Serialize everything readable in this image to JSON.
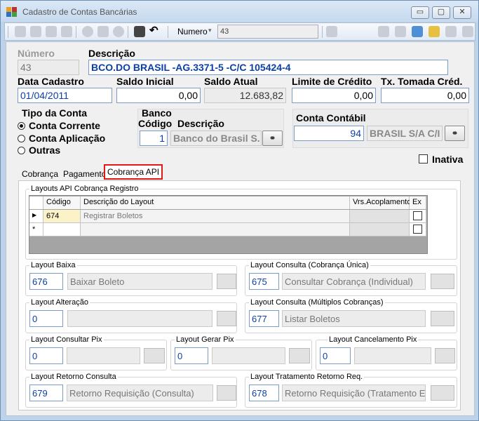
{
  "window": {
    "title": "Cadastro de Contas Bancárias"
  },
  "toolbar": {
    "numero_label": "Numero",
    "numero_value": "43"
  },
  "form": {
    "numero_label": "Número",
    "numero_value": "43",
    "descricao_label": "Descrição",
    "descricao_value": "BCO.DO BRASIL -AG.3371-5 -C/C 105424-4",
    "data_cadastro_label": "Data Cadastro",
    "data_cadastro_value": "01/04/2011",
    "saldo_inicial_label": "Saldo Inicial",
    "saldo_inicial_value": "0,00",
    "saldo_atual_label": "Saldo Atual",
    "saldo_atual_value": "12.683,82",
    "limite_credito_label": "Limite de Crédito",
    "limite_credito_value": "0,00",
    "tx_tomada_label": "Tx. Tomada Créd.",
    "tx_tomada_value": "0,00",
    "tipo_conta_label": "Tipo da Conta",
    "tipo_options": [
      {
        "label": "Conta Corrente",
        "selected": true
      },
      {
        "label": "Conta Aplicação",
        "selected": false
      },
      {
        "label": "Outras",
        "selected": false
      }
    ],
    "banco_label": "Banco",
    "banco_codigo_label": "Código",
    "banco_descricao_label": "Descrição",
    "banco_codigo_value": "1",
    "banco_descricao_value": "Banco do Brasil S.",
    "conta_contabil_label": "Conta Contábil",
    "conta_contabil_codigo": "94",
    "conta_contabil_desc": "BRASIL S/A C/I",
    "inativa_label": "Inativa"
  },
  "tabs": [
    {
      "label": "Cobrança"
    },
    {
      "label": "Pagamento"
    },
    {
      "label": "Cobrança API",
      "active": true
    }
  ],
  "cobranca_api": {
    "layouts_registro_label": "Layouts API Cobrança Registro",
    "grid": {
      "columns": [
        "Código",
        "Descrição do Layout",
        "Vrs.Acoplamento",
        "Ex"
      ],
      "rows": [
        {
          "codigo": "674",
          "descricao": "Registrar Boletos"
        }
      ]
    },
    "layout_baixa": {
      "label": "Layout Baixa",
      "code": "676",
      "desc": "Baixar Boleto"
    },
    "layout_consulta_unica": {
      "label": "Layout Consulta (Cobrança Única)",
      "code": "675",
      "desc": "Consultar Cobrança (Individual)"
    },
    "layout_alteracao": {
      "label": "Layout Alteração",
      "code": "0",
      "desc": ""
    },
    "layout_consulta_multiplos": {
      "label": "Layout Consulta (Múltiplos Cobranças)",
      "code": "677",
      "desc": "Listar Boletos"
    },
    "layout_consultar_pix": {
      "label": "Layout Consultar Pix",
      "code": "0",
      "desc": ""
    },
    "layout_gerar_pix": {
      "label": "Layout Gerar Pix",
      "code": "0",
      "desc": ""
    },
    "layout_cancelamento_pix": {
      "label": "Layout Cancelamento Pix",
      "code": "0",
      "desc": ""
    },
    "layout_retorno_consulta": {
      "label": "Layout Retorno Consulta",
      "code": "679",
      "desc": "Retorno Requisição (Consulta)"
    },
    "layout_tratamento_retorno": {
      "label": "Layout Tratamento Retorno Req.",
      "code": "678",
      "desc": "Retorno Requisição (Tratamento E"
    }
  }
}
